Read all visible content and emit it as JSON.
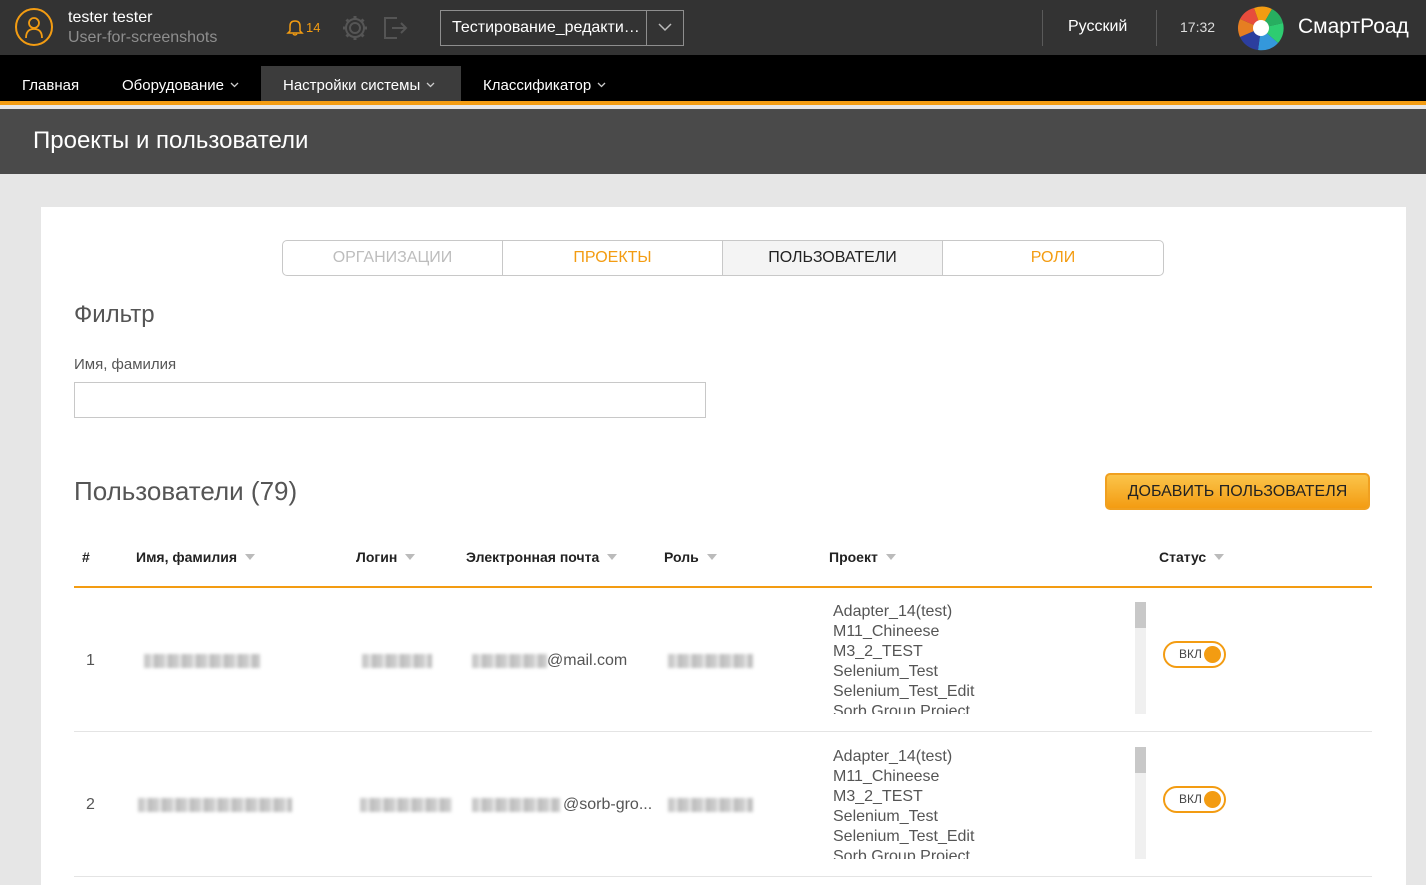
{
  "user": {
    "name": "tester tester",
    "subtitle": "User-for-screenshots"
  },
  "notifications": {
    "count": "14"
  },
  "project_selector": {
    "value": "Тестирование_редактирование"
  },
  "language": "Русский",
  "time": "17:32",
  "brand": {
    "name": "СмартРоад"
  },
  "nav": [
    {
      "label": "Главная"
    },
    {
      "label": "Оборудование"
    },
    {
      "label": "Настройки системы"
    },
    {
      "label": "Классификатор"
    }
  ],
  "page_title": "Проекты и пользователи",
  "tabs": [
    {
      "label": "Организации"
    },
    {
      "label": "Проекты"
    },
    {
      "label": "Пользователи"
    },
    {
      "label": "Роли"
    }
  ],
  "filter": {
    "title": "Фильтр",
    "name_label": "Имя, фамилия",
    "name_value": ""
  },
  "users_title": "Пользователи (79)",
  "add_button": "ДОБАВИТЬ ПОЛЬЗОВАТЕЛЯ",
  "columns": [
    "#",
    "Имя, фамилия",
    "Логин",
    "Электронная почта",
    "Роль",
    "Проект",
    "Статус"
  ],
  "rows": [
    {
      "num": "1",
      "email_suffix": "@mail.com",
      "projects": [
        "Adapter_14(test)",
        "M11_Chineese",
        "M3_2_TEST",
        "Selenium_Test",
        "Selenium_Test_Edit",
        "Sorb Group Project"
      ],
      "status": "ВКЛ"
    },
    {
      "num": "2",
      "email_suffix": "@sorb-gro...",
      "projects": [
        "Adapter_14(test)",
        "M11_Chineese",
        "M3_2_TEST",
        "Selenium_Test",
        "Selenium_Test_Edit",
        "Sorb Group Project"
      ],
      "status": "ВКЛ"
    }
  ],
  "colors": {
    "accent": "#f39c12",
    "topbar": "#333333",
    "navbar": "#000000"
  }
}
